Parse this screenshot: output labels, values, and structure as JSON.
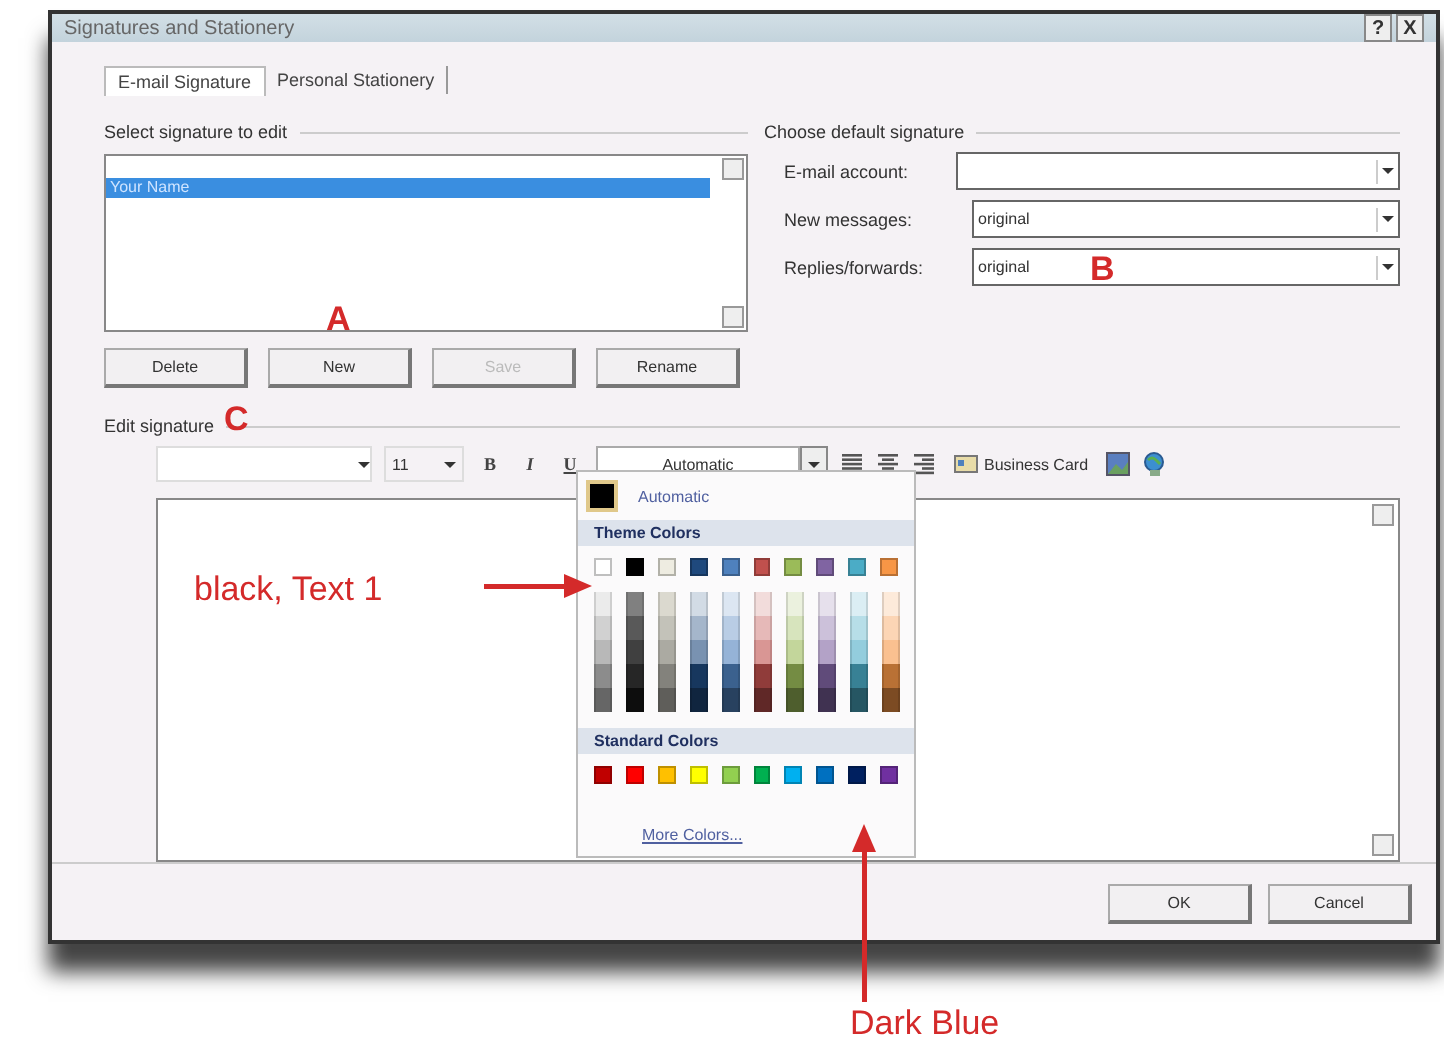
{
  "window": {
    "title": "Signatures and Stationery",
    "title_buttons": [
      "?",
      "X"
    ]
  },
  "tabs": [
    {
      "label": "E-mail Signature",
      "selected": true
    },
    {
      "label": "Personal Stationery",
      "selected": false
    }
  ],
  "select_signature": {
    "heading": "Select signature to edit",
    "items": [
      {
        "label": "Your Name",
        "selected": true
      }
    ],
    "buttons": [
      {
        "label": "Delete",
        "disabled": false
      },
      {
        "label": "New",
        "disabled": false
      },
      {
        "label": "Save",
        "disabled": true
      },
      {
        "label": "Rename",
        "disabled": false
      }
    ]
  },
  "default_signature": {
    "heading": "Choose default signature",
    "fields": [
      {
        "label": "E-mail account:"
      },
      {
        "label": "New messages:",
        "value": "original"
      },
      {
        "label": "Replies/forwards:",
        "value": "original"
      }
    ]
  },
  "edit_signature": {
    "heading": "Edit signature",
    "font_size": "11",
    "format_buttons": [
      "B",
      "I",
      "U"
    ],
    "font_color": "Automatic",
    "business_card": "Business Card"
  },
  "color_menu": {
    "automatic": "Automatic",
    "theme_heading": "Theme Colors",
    "theme_colors": [
      {
        "color": "#ffffff"
      },
      {
        "color": "#000000"
      },
      {
        "color": "#eeece1"
      },
      {
        "color": "#1f497d"
      },
      {
        "color": "#4f81bd"
      },
      {
        "color": "#c0504d"
      },
      {
        "color": "#9bbb59"
      },
      {
        "color": "#8064a2"
      },
      {
        "color": "#4bacc6"
      },
      {
        "color": "#f79646"
      }
    ],
    "standard_heading": "Standard Colors",
    "standard_colors": [
      {
        "color": "#c00000"
      },
      {
        "color": "#ff0000"
      },
      {
        "color": "#ffc000"
      },
      {
        "color": "#ffff00"
      },
      {
        "color": "#92d050"
      },
      {
        "color": "#00b050"
      },
      {
        "color": "#00b0f0"
      },
      {
        "color": "#0070c0"
      },
      {
        "color": "#002060"
      },
      {
        "color": "#7030a0"
      }
    ],
    "more": "More Colors..."
  },
  "footer_buttons": [
    "OK",
    "Cancel"
  ],
  "annotations": [
    {
      "kind": "letter",
      "text": "A"
    },
    {
      "kind": "letter",
      "text": "B"
    },
    {
      "kind": "letter",
      "text": "C"
    },
    {
      "kind": "callout",
      "text": "black, Text 1"
    },
    {
      "kind": "callout",
      "text": "Dark Blue"
    }
  ]
}
